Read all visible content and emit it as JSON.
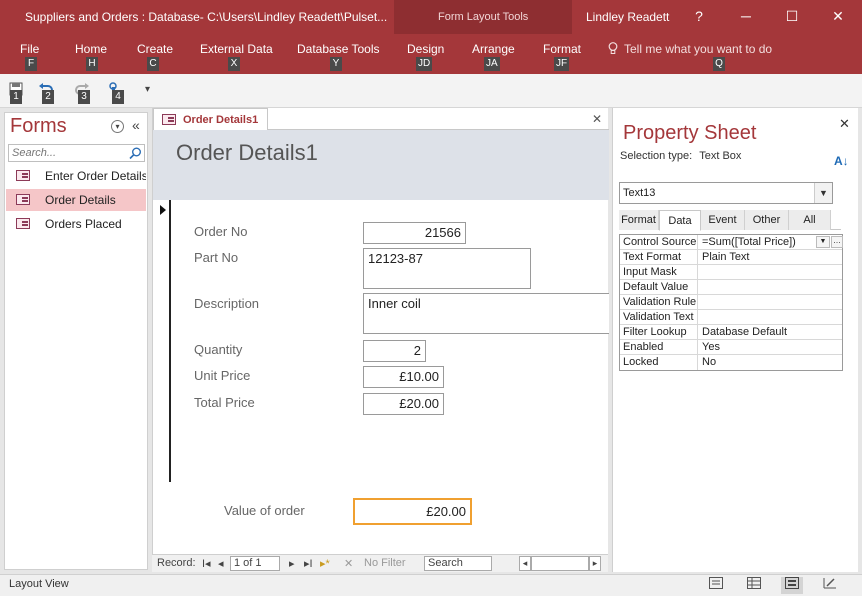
{
  "window": {
    "title": "Suppliers and Orders : Database- C:\\Users\\Lindley Readett\\Pulset...",
    "context_tools": "Form Layout Tools",
    "user": "Lindley Readett",
    "help": "?",
    "minimize": "─",
    "maximize": "☐",
    "close": "✕"
  },
  "ribbon": {
    "tabs": [
      {
        "label": "File",
        "key": "F"
      },
      {
        "label": "Home",
        "key": "H"
      },
      {
        "label": "Create",
        "key": "C"
      },
      {
        "label": "External Data",
        "key": "X"
      },
      {
        "label": "Database Tools",
        "key": "Y"
      },
      {
        "label": "Design",
        "key": "JD"
      },
      {
        "label": "Arrange",
        "key": "JA"
      },
      {
        "label": "Format",
        "key": "JF"
      }
    ],
    "tellme": "Tell me what you want to do",
    "tellme_key": "Q"
  },
  "qat": {
    "keytips": [
      "1",
      "2",
      "3",
      "4"
    ],
    "customize": "▾"
  },
  "nav": {
    "title": "Forms",
    "search_placeholder": "Search...",
    "items": [
      {
        "label": "Enter Order Details"
      },
      {
        "label": "Order Details"
      },
      {
        "label": "Orders Placed"
      }
    ]
  },
  "document": {
    "tab_label": "Order Details1",
    "close": "✕",
    "form_title": "Order Details1",
    "fields": {
      "order_no": {
        "label": "Order No",
        "value": "21566"
      },
      "part_no": {
        "label": "Part No",
        "value": "12123-87"
      },
      "description": {
        "label": "Description",
        "value": "Inner coil"
      },
      "quantity": {
        "label": "Quantity",
        "value": "2"
      },
      "unit_price": {
        "label": "Unit Price",
        "value": "£10.00"
      },
      "total_price": {
        "label": "Total Price",
        "value": "£20.00"
      },
      "value_of_order": {
        "label": "Value of order",
        "value": "£20.00"
      }
    }
  },
  "record_nav": {
    "label": "Record:",
    "first": "I◂",
    "prev": "◂",
    "current": "1 of 1",
    "next": "▸",
    "last": "▸I",
    "new": "▸*",
    "filter": "No Filter",
    "search": "Search"
  },
  "property_sheet": {
    "title": "Property Sheet",
    "selection_type_label": "Selection type:",
    "selection_type": "Text Box",
    "selected_object": "Text13",
    "tabs": [
      "Format",
      "Data",
      "Event",
      "Other",
      "All"
    ],
    "active_tab": "Data",
    "rows": [
      {
        "name": "Control Source",
        "value": "=Sum([Total Price])"
      },
      {
        "name": "Text Format",
        "value": "Plain Text"
      },
      {
        "name": "Input Mask",
        "value": ""
      },
      {
        "name": "Default Value",
        "value": ""
      },
      {
        "name": "Validation Rule",
        "value": ""
      },
      {
        "name": "Validation Text",
        "value": ""
      },
      {
        "name": "Filter Lookup",
        "value": "Database Default"
      },
      {
        "name": "Enabled",
        "value": "Yes"
      },
      {
        "name": "Locked",
        "value": "No"
      }
    ]
  },
  "status": {
    "text": "Layout View"
  },
  "colors": {
    "accent": "#a4373a",
    "focus_outline": "#f0a030",
    "nav_selected": "#f5c6c8"
  }
}
